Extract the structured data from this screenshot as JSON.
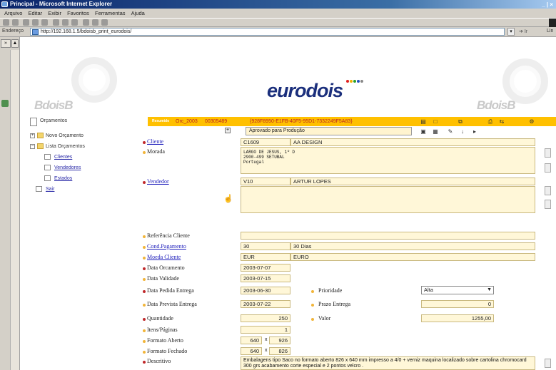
{
  "window": {
    "title": "Principal - Microsoft Internet Explorer",
    "controls": "_ | ×"
  },
  "menu": [
    "Arquivo",
    "Editar",
    "Exibir",
    "Favoritos",
    "Ferramentas",
    "Ajuda"
  ],
  "addressbar": {
    "label": "Endereço",
    "url": "http://192.168.1.5/bdoisb_print_eurodois/",
    "go": "Ir",
    "links": "Lin"
  },
  "left_strip": {
    "collapse": "»",
    "scroll_up": "▲"
  },
  "brand": {
    "name": "eurodois",
    "small_left": "BdoisB",
    "small_right": "BdoisB",
    "dots": [
      "#e02020",
      "#f0b000",
      "#2aa02a",
      "#2050c0",
      "#888"
    ]
  },
  "nav": {
    "root": "Orçamentos",
    "items": [
      {
        "label": "Novo Orçamento",
        "type": "folder",
        "indent": 0
      },
      {
        "label": "Lista Orçamentos",
        "type": "folder",
        "indent": 0
      },
      {
        "label": "Clientes",
        "type": "doc",
        "indent": 1
      },
      {
        "label": "Vendedores",
        "type": "doc",
        "indent": 1
      },
      {
        "label": "Estados",
        "type": "doc",
        "indent": 1
      },
      {
        "label": "Sair",
        "type": "doc",
        "indent": 0
      }
    ]
  },
  "header": {
    "tag": "Resumido",
    "orc": "Orc_2003",
    "num": "00305489",
    "guid": "{928F8950-E1FB-40F5-95D1-7332249F5A83}",
    "state": "Aprovado para Produção",
    "expander": "+"
  },
  "colors": {
    "header": "#ffc000",
    "field_bg": "#fff7d8",
    "required_dot": "#c0282b",
    "optional_dot": "#f1b53a",
    "link": "#1d1dbb",
    "brand": "#1b2f7c"
  },
  "form": {
    "cliente": {
      "label": "Cliente",
      "code": "C1609",
      "name": "AA DESIGN"
    },
    "morada": {
      "label": "Morada",
      "text": "LARGO DE JESUS, 1º D\n2900-499 SETUBAL\nPortugal"
    },
    "vendedor": {
      "label": "Vendedor",
      "code": "V10",
      "name": "ARTUR LOPES"
    },
    "referencia": {
      "label": "Referência Cliente",
      "value": ""
    },
    "cond_pag": {
      "label": "Cond.Pagamento",
      "code": "30",
      "text": "30 Dias"
    },
    "moeda": {
      "label": "Moeda Cliente",
      "code": "EUR",
      "text": "EURO"
    },
    "data_orc": {
      "label": "Data Orcamento",
      "value": "2003-07-07"
    },
    "data_val": {
      "label": "Data Validade",
      "value": "2003-07-15"
    },
    "data_ped": {
      "label": "Data Pedida Entrega",
      "value": "2003-06-30"
    },
    "prioridade": {
      "label": "Prioridade",
      "value": "Alta"
    },
    "data_prev": {
      "label": "Data Prevista Entrega",
      "value": "2003-07-22"
    },
    "prazo": {
      "label": "Prazo Entrega",
      "value": "0"
    },
    "quantidade": {
      "label": "Quantidade",
      "value": "250"
    },
    "valor": {
      "label": "Valor",
      "value": "1255,00"
    },
    "itens": {
      "label": "Itens/Páginas",
      "value": "1"
    },
    "formato_aberto": {
      "label": "Formato Aberto",
      "w": "640",
      "x": "x",
      "h": "926"
    },
    "formato_fechado": {
      "label": "Formato Fechado",
      "w": "640",
      "x": "x",
      "h": "826"
    },
    "descritivo": {
      "label": "Descritivo",
      "text": "Embalagens tipo Saco no formato aberto 826 x 640 mm impresso a 4/0 + verniz maquina localizado sobre cartolina chromocard 300 grs acabamento corte especial e 2 pontos velcro ."
    }
  }
}
